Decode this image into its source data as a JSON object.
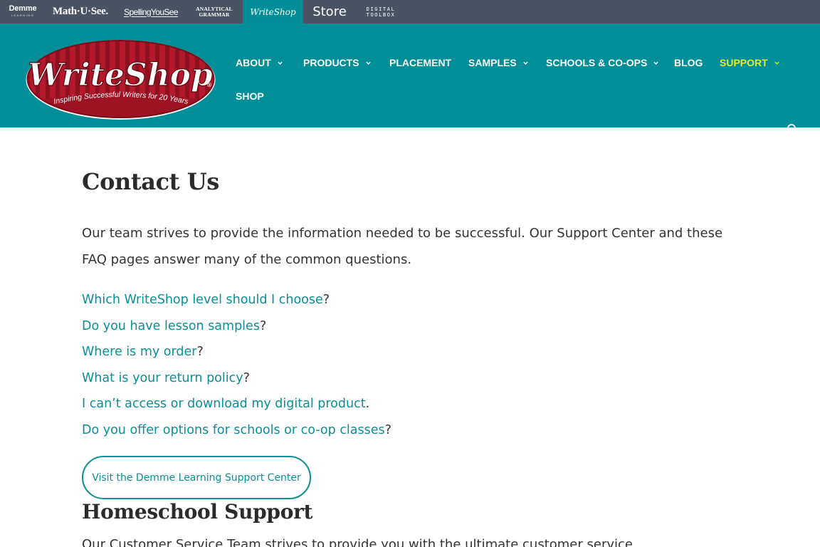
{
  "brandbar": {
    "demme": "Demme",
    "demme_sub": "LEARNING",
    "math": "Math·U·See.",
    "spelling": "SpellingYouSee",
    "analytical_1": "ANALYTICAL",
    "analytical_2": "GRAMMAR",
    "writeshop": "WriteShop",
    "store": "Store",
    "digital_1": "DIGITAL",
    "digital_2": "TOOLBOX"
  },
  "logo": {
    "wordmark": "WriteShop",
    "tagline": "Inspiring Successful Writers for 20 Years",
    "registered": "®"
  },
  "nav": {
    "about": "ABOUT",
    "products": "PRODUCTS",
    "placement": "PLACEMENT",
    "samples": "SAMPLES",
    "schools": "SCHOOLS & CO-OPS",
    "blog": "BLOG",
    "support": "SUPPORT",
    "shop": "SHOP"
  },
  "colors": {
    "brandbar_bg": "#495362",
    "header_teal": "#008e99",
    "link_teal": "#0a8f98",
    "nav_active": "#e3f02b",
    "logo_red": "#b3192b"
  },
  "page": {
    "title": "Contact Us",
    "intro": "Our team strives to provide the information needed to be successful. Our Support Center and these FAQ pages answer many of the common questions.",
    "faq": [
      {
        "link": "Which WriteShop level should I choose",
        "end": "?"
      },
      {
        "link": "Do you have lesson samples",
        "end": "?"
      },
      {
        "link": "Where is my order",
        "end": "?"
      },
      {
        "link": "What is your return policy",
        "end": "?"
      },
      {
        "link": "I can’t access or download my digital product",
        "end": "."
      },
      {
        "link": "Do you offer options for schools or co-op classes",
        "end": "?"
      }
    ],
    "support_button": "Visit the Demme Learning Support Center",
    "section_title": "Homeschool Support",
    "section_text": "Our Customer Service Team strives to provide you with the ultimate customer service"
  }
}
